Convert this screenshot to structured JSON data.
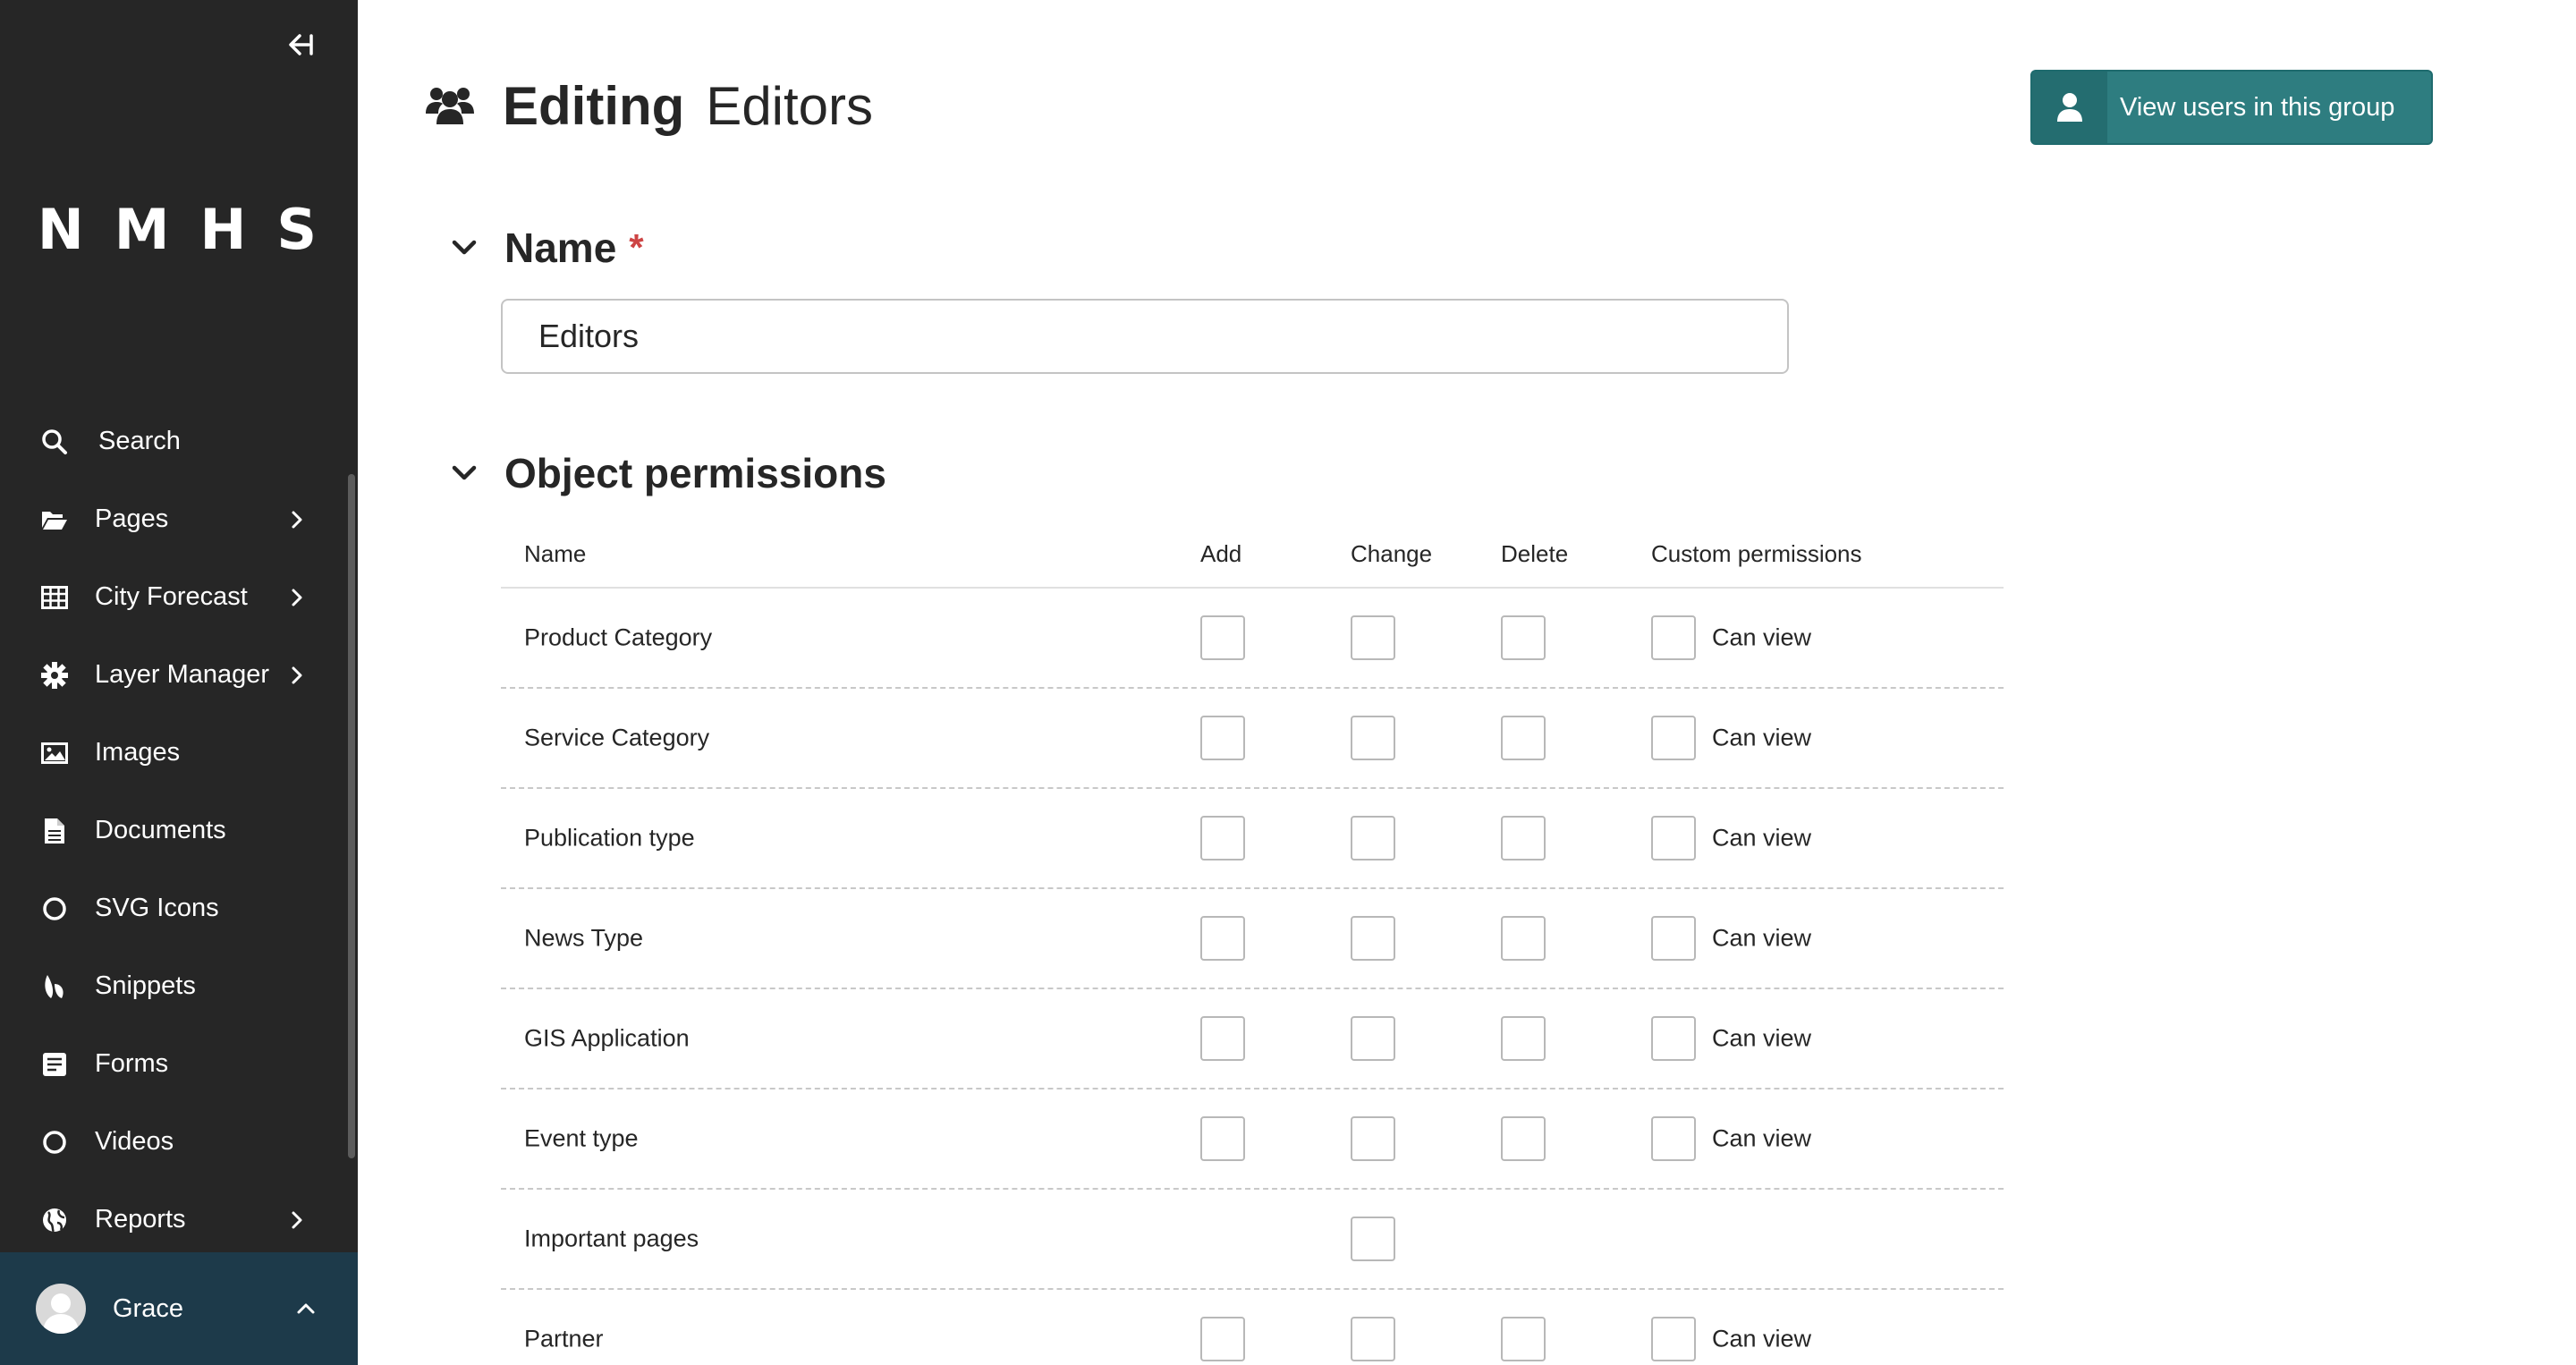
{
  "sidebar": {
    "logo": "NMHS",
    "items": [
      {
        "label": "Search",
        "icon": "search-icon",
        "has_children": false
      },
      {
        "label": "Pages",
        "icon": "folder-open-icon",
        "has_children": true
      },
      {
        "label": "City Forecast",
        "icon": "table-icon",
        "has_children": true
      },
      {
        "label": "Layer Manager",
        "icon": "gear-icon",
        "has_children": true
      },
      {
        "label": "Images",
        "icon": "image-icon",
        "has_children": false
      },
      {
        "label": "Documents",
        "icon": "document-icon",
        "has_children": false
      },
      {
        "label": "SVG Icons",
        "icon": "circle-icon",
        "has_children": false
      },
      {
        "label": "Snippets",
        "icon": "snippet-icon",
        "has_children": false
      },
      {
        "label": "Forms",
        "icon": "form-icon",
        "has_children": false
      },
      {
        "label": "Videos",
        "icon": "circle-icon",
        "has_children": false
      },
      {
        "label": "Reports",
        "icon": "globe-icon",
        "has_children": true
      }
    ],
    "account": {
      "name": "Grace"
    }
  },
  "header": {
    "title_strong": "Editing",
    "title_light": "Editors",
    "view_users_label": "View users in this group"
  },
  "name_section": {
    "title": "Name",
    "required_mark": "*",
    "value": "Editors"
  },
  "permissions": {
    "title": "Object permissions",
    "columns": {
      "name": "Name",
      "add": "Add",
      "change": "Change",
      "delete": "Delete",
      "custom": "Custom permissions"
    },
    "rows": [
      {
        "name": "Product Category",
        "custom": "Can view"
      },
      {
        "name": "Service Category",
        "custom": "Can view"
      },
      {
        "name": "Publication type",
        "custom": "Can view"
      },
      {
        "name": "News Type",
        "custom": "Can view"
      },
      {
        "name": "GIS Application",
        "custom": "Can view"
      },
      {
        "name": "Event type",
        "custom": "Can view"
      },
      {
        "name": "Important pages",
        "custom": ""
      },
      {
        "name": "Partner",
        "custom": "Can view"
      }
    ]
  },
  "colors": {
    "sidebar_bg": "#262626",
    "account_bg": "#1d3a4a",
    "button_teal": "#2e7d80",
    "required_red": "#cd4444"
  }
}
